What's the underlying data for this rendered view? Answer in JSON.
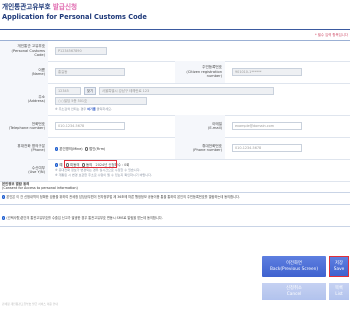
{
  "header": {
    "title_prefix": "개인통관고유부호 ",
    "title_highlight": "발급신청",
    "subtitle": "Application for Personal Customs Code",
    "required_note": "* 필수 입력 항목입니다"
  },
  "form": {
    "customs_code": {
      "label_ko": "개인통관 고유부호",
      "label_en": "(Personal Customs Code)",
      "value": "P1234567890"
    },
    "name": {
      "label_ko": "이름",
      "label_en": "(Name)",
      "value": "홍길동"
    },
    "reg_number": {
      "label_ko": "주민등록번호",
      "label_en": "(Citizen registration number)",
      "value": "901010-1******"
    },
    "address": {
      "label_ko": "주소",
      "label_en": "(Address)",
      "zip": "12345",
      "search_label": "찾기",
      "line1": "서울특별시 강남구 테헤란로 123",
      "line2": "○○빌딩 5층 501호",
      "note_prefix": "※ 주소검색 안되는 경우 ",
      "note_link": "여기를",
      "note_suffix": " 클릭하세요."
    },
    "phone": {
      "label_ko": "전화번호",
      "label_en": "(Telephone number)",
      "value": "010-1234-5678"
    },
    "email": {
      "label_ko": "이메일",
      "label_en": "(E-mail)",
      "value": "example@domain.com"
    },
    "mobile_type": {
      "label_ko": "휴대전화 명의구분",
      "label_en": "(Phone)",
      "option_own": "본인명의(Mine)",
      "option_other": "법인(Firm)"
    },
    "mobile": {
      "label_ko": "휴대전화번호",
      "label_en": "(Phone number)",
      "value": "010-1234-5678"
    },
    "sms": {
      "label_ko": "수신여부",
      "label_en": "(Use Y/N)",
      "option_yes": "예",
      "option_no_agree": "미동의",
      "option_agree": "동의",
      "note_date": "2024년 신청확수 : 0회",
      "note1": "※ 휴대전화 정보가 변경되는 경우 실시간으로 수정할 수 있습니다.",
      "note2": "※ 개통된 시 변경 보관한 주소로 수령이 될 수 있는지 확인하시기 바랍니다."
    }
  },
  "consent": {
    "title": "본인정보 열람 동의",
    "title_en": "(Consent for Access to personal information)",
    "item1": "본인은 이 건 신청내역의 정확한 검증을 위하여 관세청 담당공무원이 전자정부법 제 36조에 따른 행정정보 공동이용 통을 통하여 본인의 주민등록번호를 열람하는데 동의합니다.",
    "item2": "(선택사항)본인의 통관고유부호를 수출입 신고가 발생한 경우 통관고유부호 변동시 SMS로 알림을 받는데 동의합니다."
  },
  "buttons": {
    "prev_ko": "이전화면",
    "prev_en": "Back(Previous Screen)",
    "next_ko": "저장",
    "next_en": "Save",
    "cancel_ko": "신청취소",
    "cancel_en": "Cancel",
    "list_ko": "목록",
    "list_en": "List"
  },
  "footer": "관세청 개인통관고유부호 발급 서비스 이용 안내"
}
